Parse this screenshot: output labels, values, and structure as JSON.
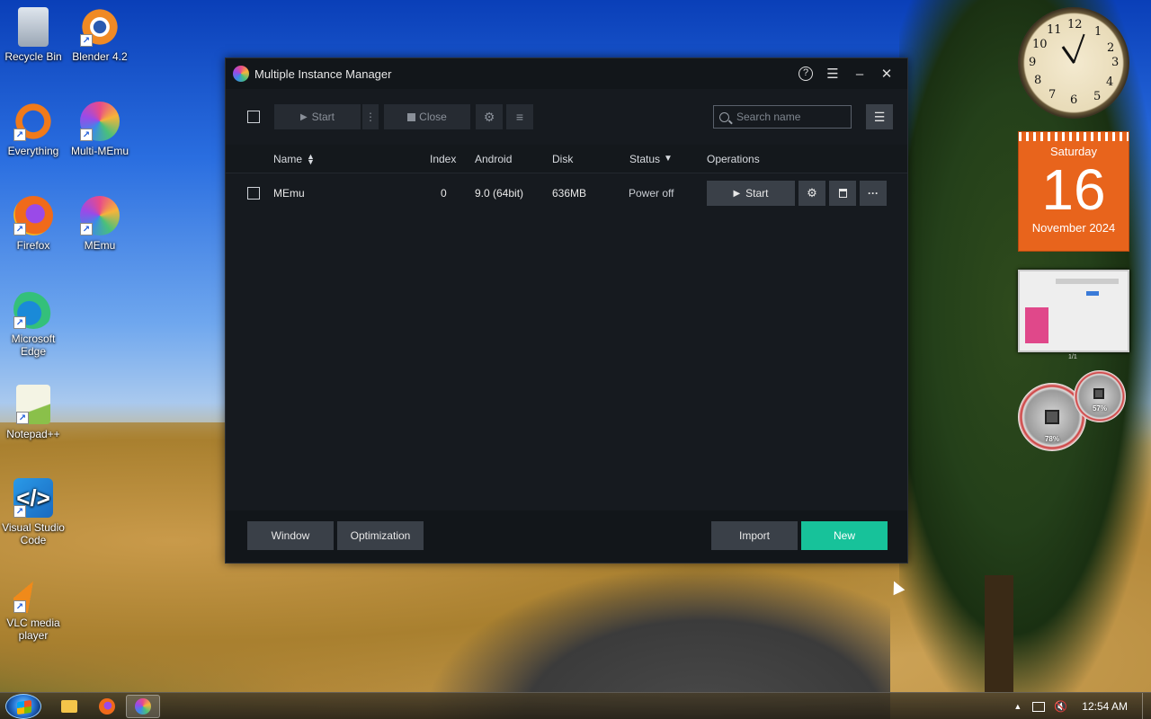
{
  "desktop": {
    "icons": [
      {
        "label": "Recycle Bin",
        "icon": "recycle-bin-icon"
      },
      {
        "label": "Blender 4.2",
        "icon": "blender-icon"
      },
      {
        "label": "Everything",
        "icon": "everything-icon"
      },
      {
        "label": "Multi-MEmu",
        "icon": "multi-memu-icon"
      },
      {
        "label": "Firefox",
        "icon": "firefox-icon"
      },
      {
        "label": "MEmu",
        "icon": "memu-icon"
      },
      {
        "label": "Microsoft Edge",
        "icon": "edge-icon"
      },
      {
        "label": "Notepad++",
        "icon": "notepadpp-icon"
      },
      {
        "label": "Visual Studio Code",
        "icon": "vscode-icon"
      },
      {
        "label": "VLC media player",
        "icon": "vlc-icon"
      }
    ]
  },
  "gadgets": {
    "clock": {
      "numbers": [
        "12",
        "1",
        "2",
        "3",
        "4",
        "5",
        "6",
        "7",
        "8",
        "9",
        "10",
        "11"
      ]
    },
    "calendar": {
      "weekday": "Saturday",
      "day": "16",
      "month_year": "November 2024"
    },
    "thumbnail": {
      "caption": "1/1"
    },
    "meters": {
      "cpu": "78%",
      "memory": "57%"
    }
  },
  "window": {
    "title": "Multiple Instance Manager",
    "controls": {
      "help": "?",
      "menu": "☰",
      "minimize": "–",
      "close": "✕"
    },
    "toolbar": {
      "start_label": "Start",
      "more_label": "⋮",
      "close_label": "Close",
      "settings_icon": "⚙",
      "menu_icon": "≡",
      "search_placeholder": "Search name",
      "list_icon": "☰"
    },
    "table": {
      "columns": {
        "name": "Name",
        "index": "Index",
        "android": "Android",
        "disk": "Disk",
        "status": "Status",
        "operations": "Operations"
      },
      "rows": [
        {
          "name": "MEmu",
          "index": "0",
          "android": "9.0 (64bit)",
          "disk": "636MB",
          "status": "Power off",
          "start_label": "Start"
        }
      ]
    },
    "footer": {
      "window_label": "Window",
      "optimization_label": "Optimization",
      "import_label": "Import",
      "new_label": "New"
    }
  },
  "taskbar": {
    "apps": [
      "file-explorer-icon",
      "firefox-icon",
      "multi-memu-icon"
    ],
    "time": "12:54 AM"
  },
  "colors": {
    "accent_new": "#17c29a",
    "window_bg": "#161a1f",
    "calendar": "#e8641c"
  }
}
